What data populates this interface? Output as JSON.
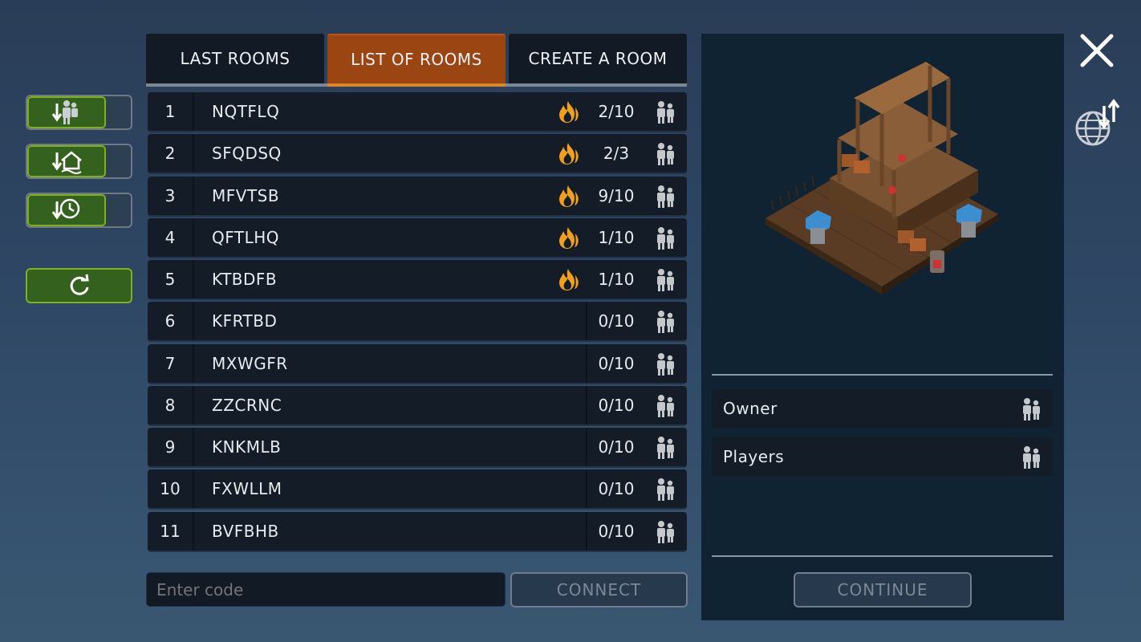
{
  "tabs": [
    {
      "label": "LAST ROOMS",
      "active": false
    },
    {
      "label": "LIST OF ROOMS",
      "active": true
    },
    {
      "label": "CREATE A ROOM",
      "active": false
    }
  ],
  "sort_buttons": [
    {
      "icon": "players-sort-icon"
    },
    {
      "icon": "house-sort-icon"
    },
    {
      "icon": "time-sort-icon"
    }
  ],
  "refresh_icon": "refresh-icon",
  "rooms": [
    {
      "index": "1",
      "name": "NQTFLQ",
      "hot": true,
      "players": "2/10"
    },
    {
      "index": "2",
      "name": "SFQDSQ",
      "hot": true,
      "players": "2/3"
    },
    {
      "index": "3",
      "name": "MFVTSB",
      "hot": true,
      "players": "9/10"
    },
    {
      "index": "4",
      "name": "QFTLHQ",
      "hot": true,
      "players": "1/10"
    },
    {
      "index": "5",
      "name": "KTBDFB",
      "hot": true,
      "players": "1/10"
    },
    {
      "index": "6",
      "name": "KFRTBD",
      "hot": false,
      "players": "0/10"
    },
    {
      "index": "7",
      "name": "MXWGFR",
      "hot": false,
      "players": "0/10"
    },
    {
      "index": "8",
      "name": "ZZCRNC",
      "hot": false,
      "players": "0/10"
    },
    {
      "index": "9",
      "name": "KNKMLB",
      "hot": false,
      "players": "0/10"
    },
    {
      "index": "10",
      "name": "FXWLLM",
      "hot": false,
      "players": "0/10"
    },
    {
      "index": "11",
      "name": "BVFBHB",
      "hot": false,
      "players": "0/10"
    }
  ],
  "code_input": {
    "placeholder": "Enter code",
    "value": ""
  },
  "connect_label": "CONNECT",
  "panel": {
    "owner_label": "Owner",
    "players_label": "Players",
    "continue_label": "CONTINUE"
  },
  "colors": {
    "accent_tab": "#9a4512",
    "button_green": "#35611f",
    "fire": "#f0a020"
  }
}
